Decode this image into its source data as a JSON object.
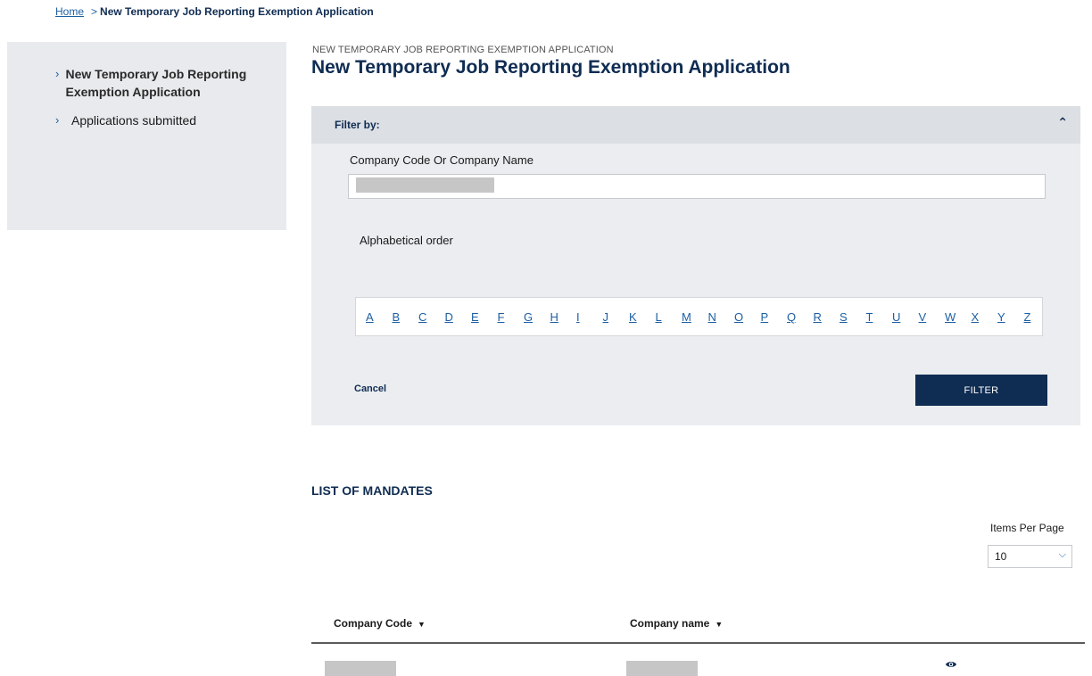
{
  "breadcrumb": {
    "home": "Home",
    "separator": ">",
    "current": "New Temporary Job Reporting Exemption Application"
  },
  "sidebar": {
    "items": [
      {
        "label": "New Temporary Job Reporting Exemption Application",
        "active": true
      },
      {
        "label": "Applications submitted",
        "active": false
      }
    ]
  },
  "page": {
    "kicker": "NEW TEMPORARY JOB REPORTING EXEMPTION APPLICATION",
    "title": "New Temporary Job Reporting Exemption Application"
  },
  "filter": {
    "header": "Filter by:",
    "field_label": "Company Code Or Company Name",
    "field_value": "",
    "alpha_label": "Alphabetical order",
    "letters": [
      "A",
      "B",
      "C",
      "D",
      "E",
      "F",
      "G",
      "H",
      "I",
      "J",
      "K",
      "L",
      "M",
      "N",
      "O",
      "P",
      "Q",
      "R",
      "S",
      "T",
      "U",
      "V",
      "W",
      "X",
      "Y",
      "Z"
    ],
    "cancel": "Cancel",
    "submit": "FILTER"
  },
  "list": {
    "title": "LIST OF MANDATES",
    "items_per_page_label": "Items Per Page",
    "items_per_page_value": "10",
    "columns": [
      "Company Code",
      "Company name"
    ]
  },
  "icons": {
    "chevron_right": "chevron-right-icon",
    "collapse": "chevron-up-icon",
    "sort": "sort-down-icon",
    "view": "eye-icon"
  },
  "colors": {
    "brand_navy": "#0f2c52",
    "link_blue": "#1d5fa3",
    "panel_bg": "#ebedf0"
  }
}
